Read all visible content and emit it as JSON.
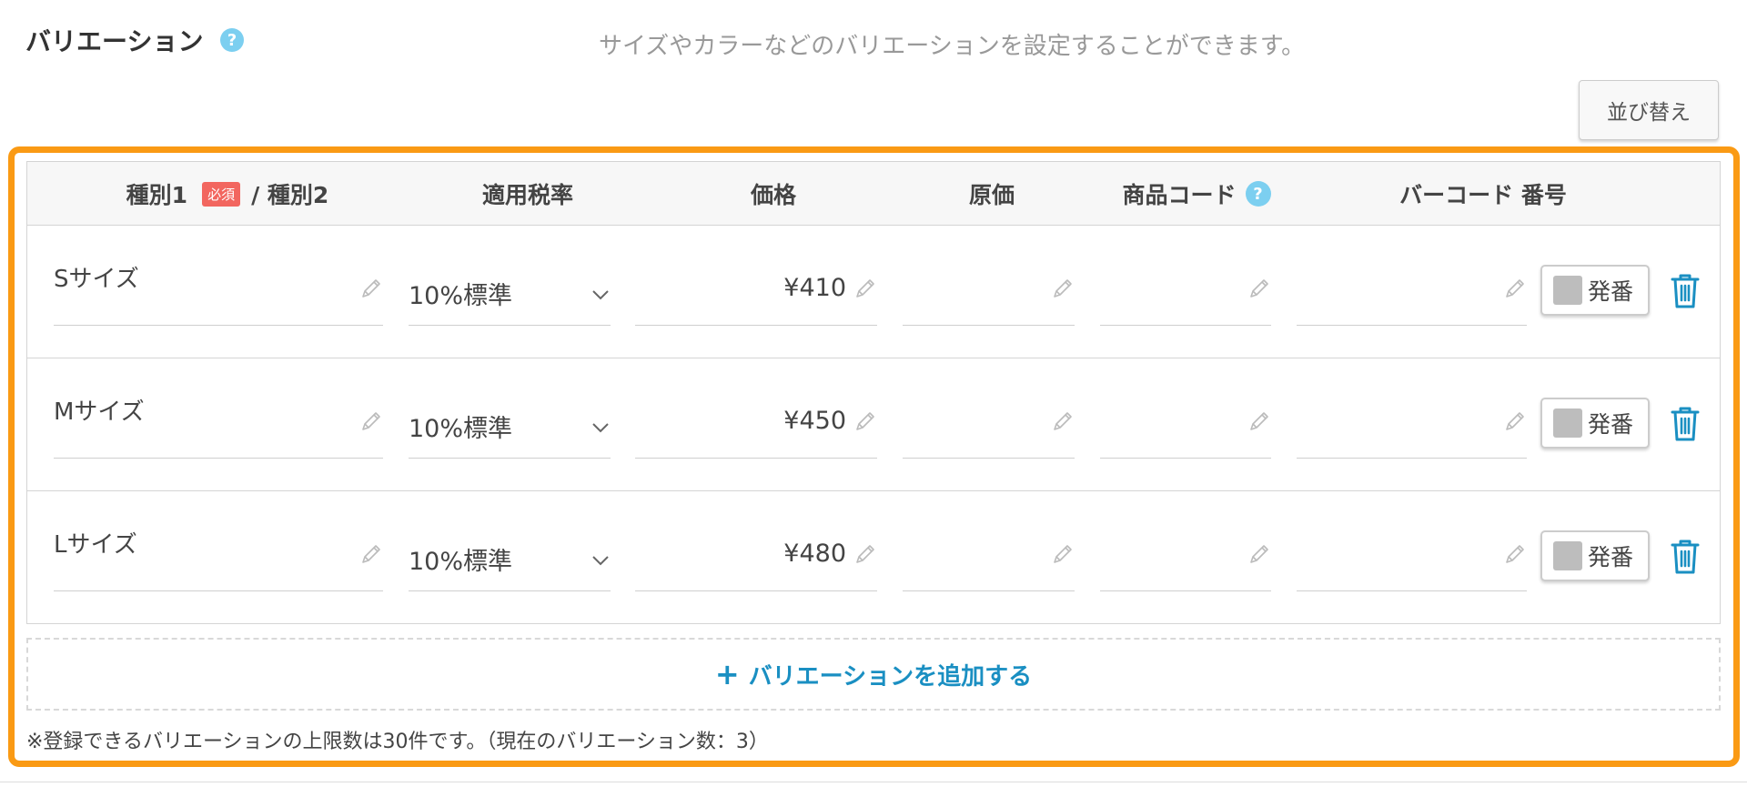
{
  "section": {
    "title": "バリエーション",
    "description": "サイズやカラーなどのバリエーションを設定することができます。",
    "sort_label": "並び替え"
  },
  "table": {
    "headers": {
      "type1": "種別1",
      "required": "必須",
      "type2": "/ 種別2",
      "tax_rate": "適用税率",
      "price": "価格",
      "cost": "原価",
      "product_code": "商品コード",
      "barcode": "バーコード 番号"
    },
    "rows": [
      {
        "name": "Sサイズ",
        "tax": "10%標準",
        "price": "¥410",
        "cost": "",
        "code": "",
        "barcode": "",
        "issue_label": "発番"
      },
      {
        "name": "Mサイズ",
        "tax": "10%標準",
        "price": "¥450",
        "cost": "",
        "code": "",
        "barcode": "",
        "issue_label": "発番"
      },
      {
        "name": "Lサイズ",
        "tax": "10%標準",
        "price": "¥480",
        "cost": "",
        "code": "",
        "barcode": "",
        "issue_label": "発番"
      }
    ]
  },
  "add_button": {
    "plus": "+",
    "label": "バリエーションを追加する"
  },
  "note": "※登録できるバリエーションの上限数は30件です。（現在のバリエーション数：3）",
  "help_mark": "?",
  "colors": {
    "accent": "#1a8fc2",
    "highlight": "#fa9a14",
    "required": "#f2665f",
    "help": "#7ccff0"
  }
}
